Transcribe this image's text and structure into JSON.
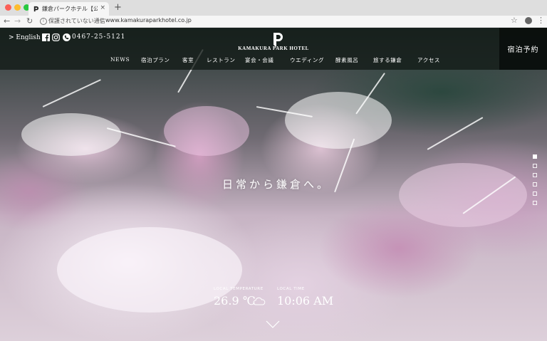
{
  "browser": {
    "tab_title": "鎌倉パークホテル【公式】| KA",
    "tab_close": "×",
    "new_tab": "+",
    "security_text": "保護されていない通信",
    "separator": "|",
    "url": "www.kamakuraparkhotel.co.jp"
  },
  "header": {
    "language_link": "> English",
    "phone": "0467-25-5121",
    "logo_text": "KAMAKURA PARK HOTEL",
    "reserve_button": "宿泊予約"
  },
  "nav": [
    {
      "label": "NEWS"
    },
    {
      "label": "宿泊プラン"
    },
    {
      "label": "客室"
    },
    {
      "label": "レストラン"
    },
    {
      "label": "宴会・会議"
    },
    {
      "label": "ウエディング"
    },
    {
      "label": "酵素風呂"
    },
    {
      "label": "旅する鎌倉"
    },
    {
      "label": "アクセス"
    }
  ],
  "hero": {
    "tagline": "日常から鎌倉へ。",
    "slides": 6,
    "active_slide": 1
  },
  "weather": {
    "temperature_label": "LOCAL TEMPERATURE",
    "temperature": "26.9 ℃",
    "time_label": "LOCAL TIME",
    "time": "10:06 AM",
    "condition_icon": "cloud-icon"
  },
  "colors": {
    "header_bg": "#121a16",
    "reserve_bg": "#0a0e0c",
    "text": "#ffffff"
  }
}
